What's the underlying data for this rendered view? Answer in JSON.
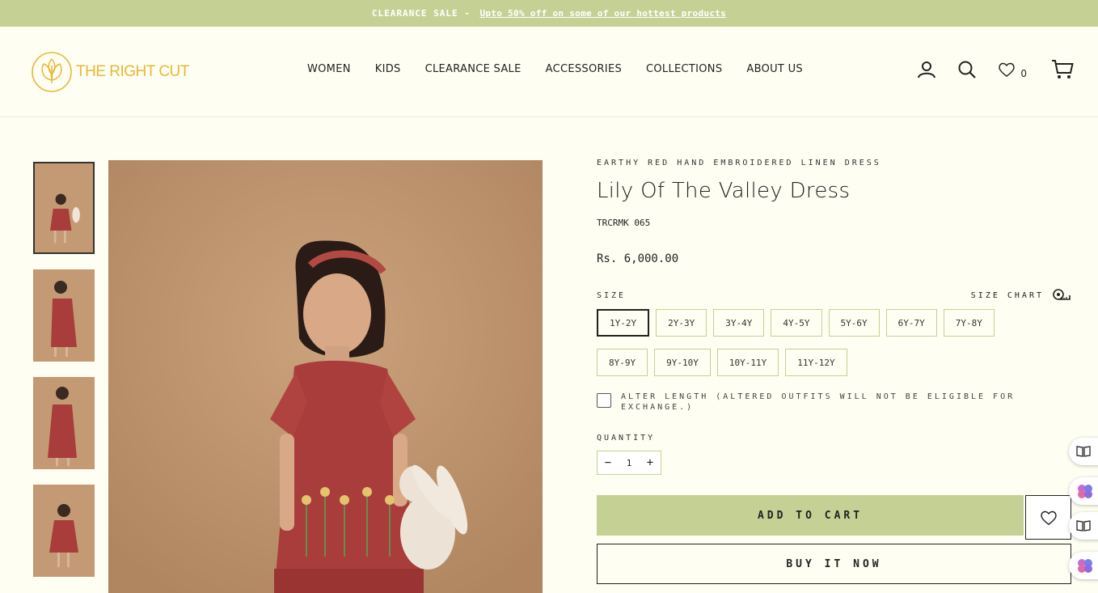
{
  "announcement": {
    "label": "CLEARANCE SALE",
    "separator": " - ",
    "link_text": "Upto 50% off on some of our hottest products"
  },
  "header": {
    "logo_text": "THE RIGHT CUT",
    "nav": [
      "WOMEN",
      "KIDS",
      "CLEARANCE SALE",
      "ACCESSORIES",
      "COLLECTIONS",
      "ABOUT US"
    ],
    "wishlist_count": "0",
    "icons": [
      "account-icon",
      "search-icon",
      "heart-icon",
      "cart-icon"
    ]
  },
  "product": {
    "subtitle": "EARTHY RED HAND EMBROIDERED LINEN DRESS",
    "title": "Lily Of The Valley Dress",
    "sku": "TRCRMK 065",
    "price": "Rs. 6,000.00",
    "size_label": "SIZE",
    "size_chart_label": "SIZE CHART",
    "sizes": [
      "1Y-2Y",
      "2Y-3Y",
      "3Y-4Y",
      "4Y-5Y",
      "5Y-6Y",
      "6Y-7Y",
      "7Y-8Y",
      "8Y-9Y",
      "9Y-10Y",
      "10Y-11Y",
      "11Y-12Y"
    ],
    "selected_size": "1Y-2Y",
    "alter_text": "ALTER LENGTH (ALTERED OUTFITS WILL NOT BE ELIGIBLE FOR EXCHANGE.)",
    "quantity_label": "QUANTITY",
    "quantity": "1",
    "add_to_cart": "ADD TO CART",
    "buy_now": "BUY IT NOW"
  },
  "colors": {
    "accent": "#c5d194",
    "background": "#fefef2",
    "logo": "#e8b736",
    "dress": "#a83d3b",
    "backdrop": "#c49a74"
  }
}
